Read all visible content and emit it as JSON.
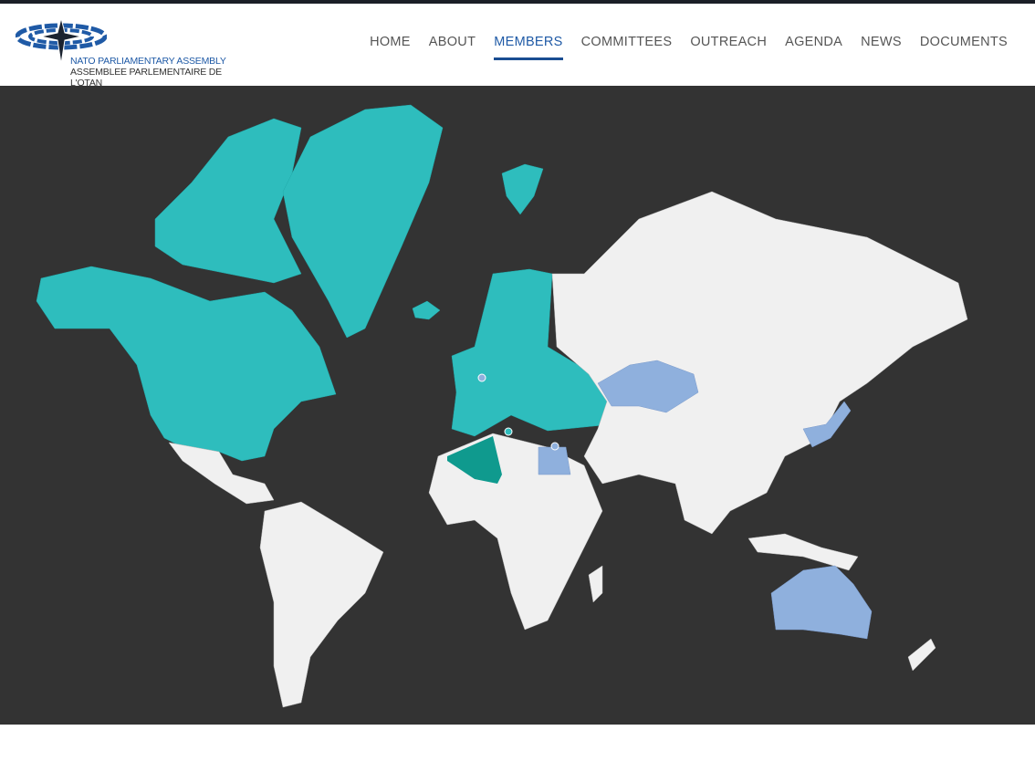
{
  "logo": {
    "line1": "NATO PARLIAMENTARY ASSEMBLY",
    "line2": "ASSEMBLEE PARLEMENTAIRE DE L'OTAN"
  },
  "nav": [
    {
      "label": "HOME"
    },
    {
      "label": "ABOUT"
    },
    {
      "label": "MEMBERS",
      "active": true
    },
    {
      "label": "COMMITTEES"
    },
    {
      "label": "OUTREACH"
    },
    {
      "label": "AGENDA"
    },
    {
      "label": "NEWS"
    },
    {
      "label": "DOCUMENTS"
    }
  ],
  "map": {
    "colors": {
      "background": "#333333",
      "member": "#2ebdbd",
      "mediterranean": "#0f9a8e",
      "partner": "#8fb0dd",
      "other": "#f0f0f0",
      "accent": "#1a4d92"
    }
  }
}
